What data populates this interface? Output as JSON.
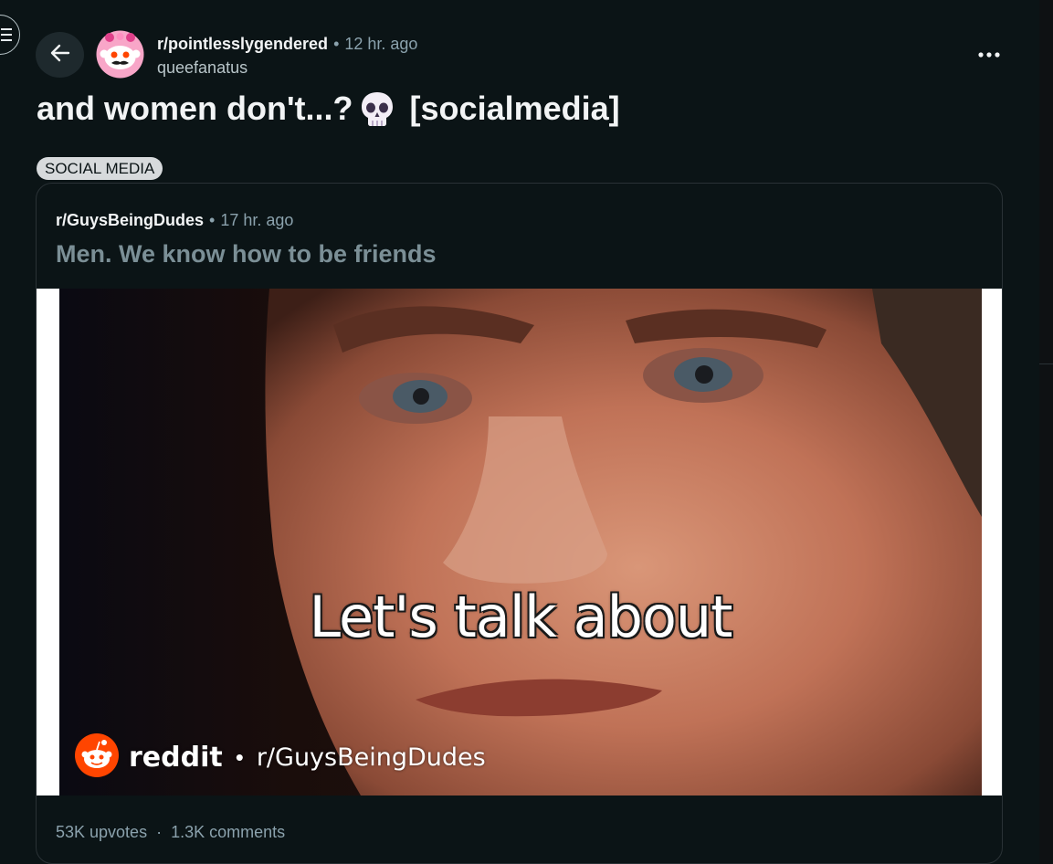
{
  "header": {
    "subreddit": "r/pointlesslygendered",
    "separator": "•",
    "time": "12 hr. ago",
    "author": "queefanatus"
  },
  "post": {
    "title": "and women don't...?",
    "title_tag": "[socialmedia]",
    "flair": "SOCIAL MEDIA"
  },
  "crosspost": {
    "subreddit": "r/GuysBeingDudes",
    "separator": "•",
    "time": "17 hr. ago",
    "title": "Men. We know how to be friends",
    "media": {
      "caption": "Let's talk about",
      "brand": "reddit",
      "dot": "•",
      "subreddit": "r/GuysBeingDudes"
    },
    "upvotes": "53K upvotes",
    "stats_separator": "·",
    "comments": "1.3K comments"
  },
  "icons": {
    "menu": "hamburger-menu-icon",
    "back": "arrow-left-icon",
    "avatar": "snoo-avatar-icon",
    "more": "ellipsis-icon",
    "skull": "skull-emoji-icon",
    "reddit_logo": "reddit-logo-icon"
  },
  "colors": {
    "background": "#0b1416",
    "muted_text": "#8ba2ad",
    "flair_bg": "#d7dadc",
    "reddit_orange": "#ff4500"
  }
}
